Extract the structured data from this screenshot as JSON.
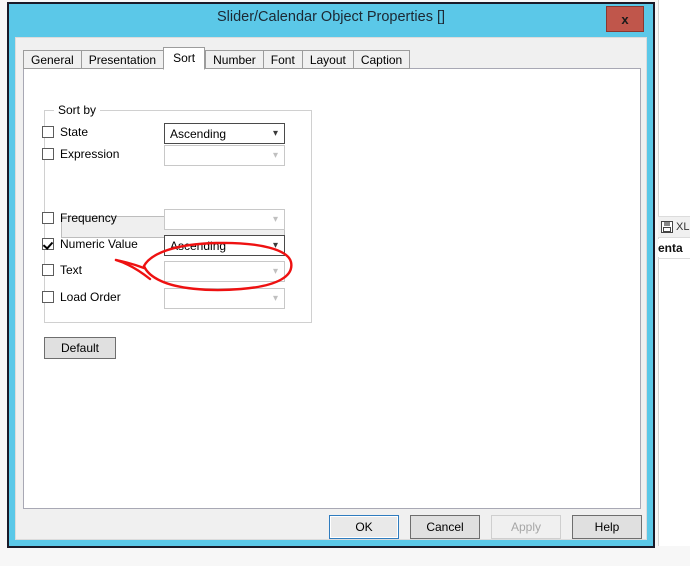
{
  "background_window": {
    "toolbar_icon": "save-disk-icon",
    "toolbar_label": "XL",
    "clipped_text": "enta"
  },
  "dialog": {
    "title": "Slider/Calendar Object Properties []",
    "close_label": "x",
    "title_bar_color": "#5bc8e8",
    "close_button_color": "#c0564b"
  },
  "tabs": [
    {
      "label": "General",
      "active": false
    },
    {
      "label": "Presentation",
      "active": false
    },
    {
      "label": "Sort",
      "active": true
    },
    {
      "label": "Number",
      "active": false
    },
    {
      "label": "Font",
      "active": false
    },
    {
      "label": "Layout",
      "active": false
    },
    {
      "label": "Caption",
      "active": false
    }
  ],
  "sort_page": {
    "group_label": "Sort by",
    "rows": [
      {
        "name": "state",
        "label": "State",
        "checked": false,
        "combo_value": "Ascending",
        "combo_enabled": true
      },
      {
        "name": "expression",
        "label": "Expression",
        "checked": false,
        "combo_value": "",
        "combo_enabled": false
      },
      {
        "name": "frequency",
        "label": "Frequency",
        "checked": false,
        "combo_value": "",
        "combo_enabled": false
      },
      {
        "name": "numeric-value",
        "label": "Numeric Value",
        "checked": true,
        "combo_value": "Ascending",
        "combo_enabled": true
      },
      {
        "name": "text",
        "label": "Text",
        "checked": false,
        "combo_value": "",
        "combo_enabled": false
      },
      {
        "name": "load-order",
        "label": "Load Order",
        "checked": false,
        "combo_value": "",
        "combo_enabled": false
      }
    ],
    "expression_input_value": "",
    "expression_input_placeholder": "",
    "default_button_label": "Default"
  },
  "annotation": {
    "shape": "hand-drawn-ellipse-with-pointer",
    "color": "#ee1111"
  },
  "footer_buttons": [
    {
      "label": "OK",
      "state": "focused"
    },
    {
      "label": "Cancel",
      "state": "normal"
    },
    {
      "label": "Apply",
      "state": "disabled"
    },
    {
      "label": "Help",
      "state": "normal"
    }
  ]
}
